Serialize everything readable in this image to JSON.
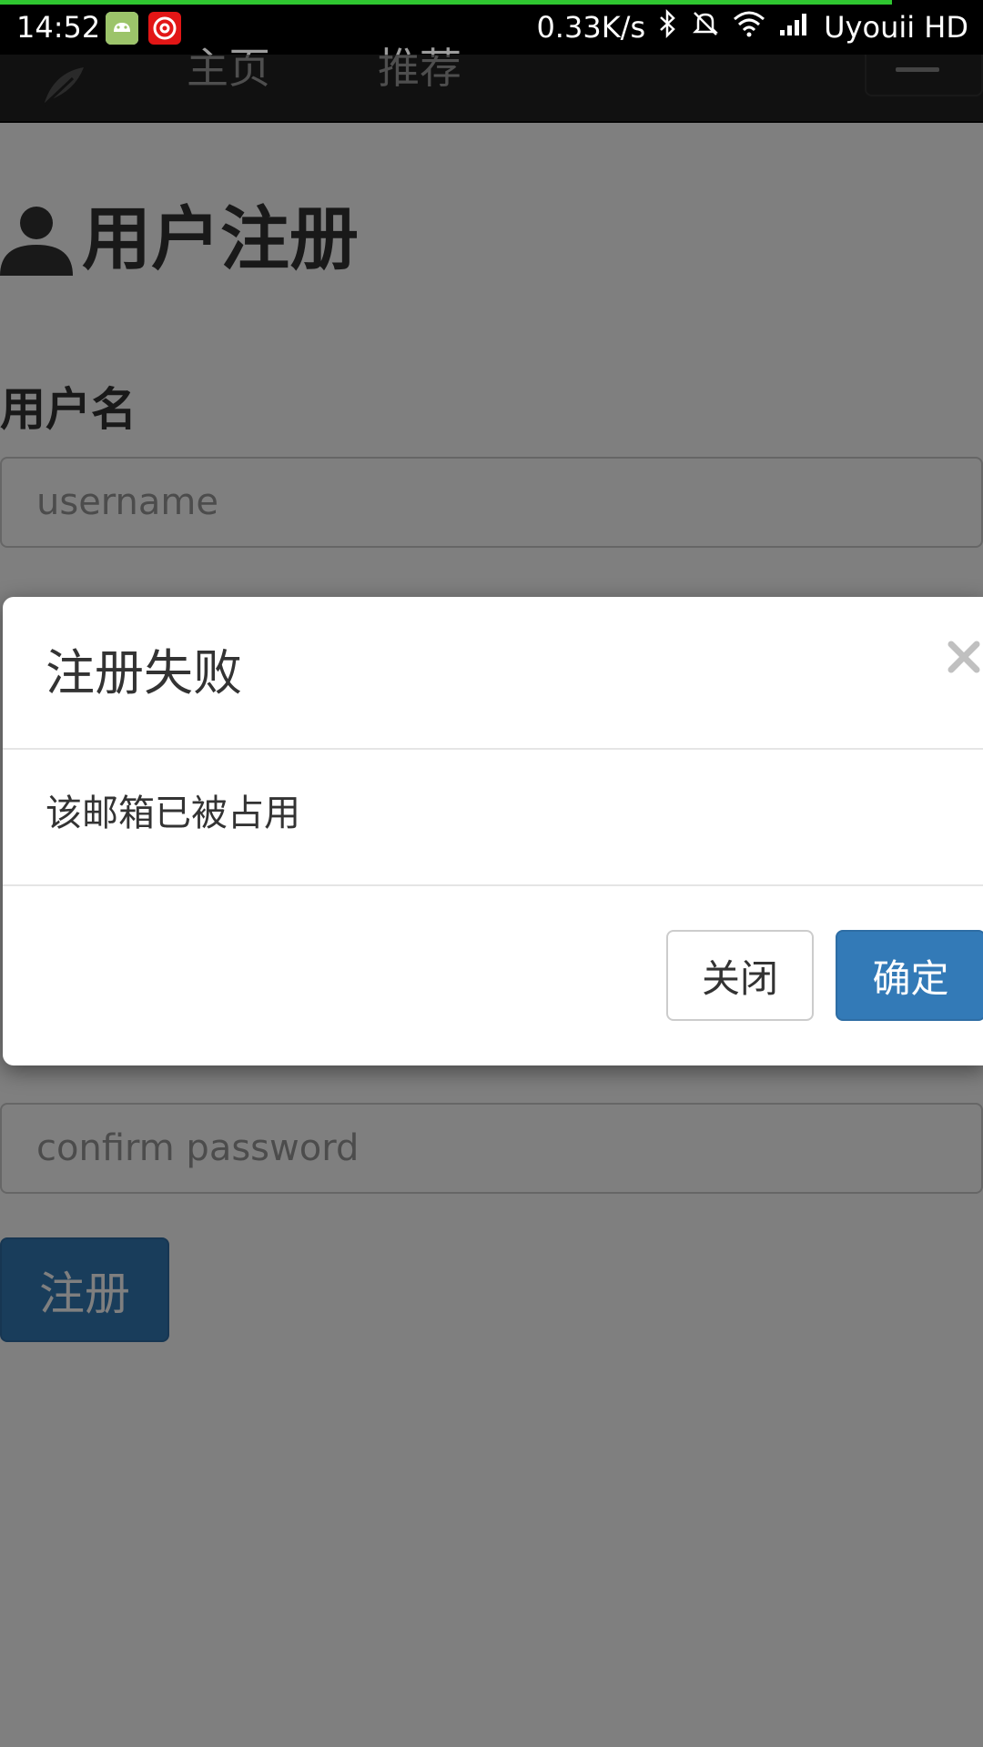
{
  "status_bar": {
    "time": "14:52",
    "network_speed": "0.33K/s",
    "carrier": "Uyouii HD",
    "progress_color": "#2fc630",
    "icons": [
      "android-icon",
      "netease-music-icon",
      "bluetooth-icon",
      "mute-icon",
      "wifi-icon",
      "signal-icon"
    ]
  },
  "navbar": {
    "links": [
      "主页",
      "推荐"
    ]
  },
  "page": {
    "title": "用户注册",
    "username_label": "用户名",
    "username_placeholder": "username",
    "confirm_placeholder": "confirm password",
    "submit_label": "注册"
  },
  "modal": {
    "title": "注册失败",
    "message": "该邮箱已被占用",
    "close_label": "关闭",
    "confirm_label": "确定",
    "primary_color": "#337ab7"
  }
}
